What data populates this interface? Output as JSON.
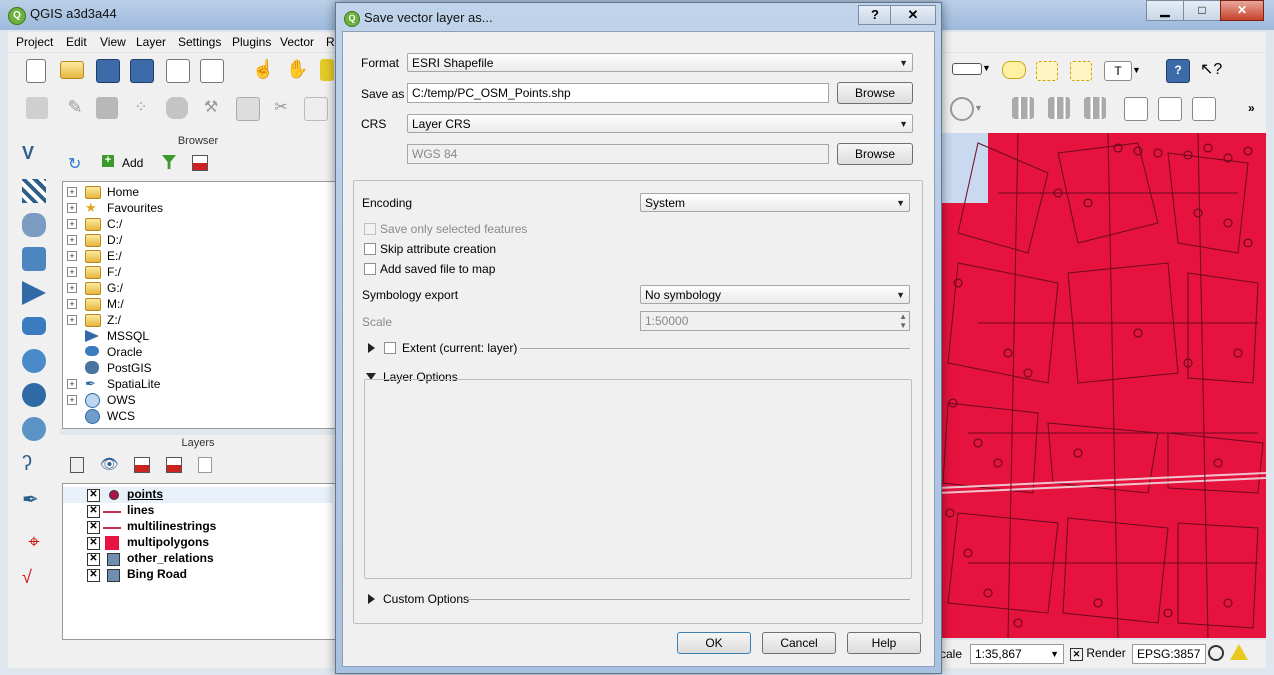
{
  "main_window": {
    "title": "QGIS a3d3a44",
    "menu": [
      "Project",
      "Edit",
      "View",
      "Layer",
      "Settings",
      "Plugins",
      "Vector",
      "Ra"
    ]
  },
  "browser": {
    "title": "Browser",
    "add_label": "Add",
    "items": [
      "Home",
      "Favourites",
      "C:/",
      "D:/",
      "E:/",
      "F:/",
      "G:/",
      "M:/",
      "Z:/",
      "MSSQL",
      "Oracle",
      "PostGIS",
      "SpatiaLite",
      "OWS",
      "WCS"
    ]
  },
  "layers": {
    "title": "Layers",
    "items": [
      "points",
      "lines",
      "multilinestrings",
      "multipolygons",
      "other_relations",
      "Bing Road"
    ]
  },
  "statusbar": {
    "scale_label": "cale",
    "scale_value": "1:35,867",
    "render_label": "Render",
    "crs": "EPSG:3857"
  },
  "dialog": {
    "title": "Save vector layer as...",
    "help_glyph": "?",
    "close_glyph": "✕",
    "format_label": "Format",
    "format_value": "ESRI Shapefile",
    "save_as_label": "Save as",
    "save_as_value": "C:/temp/PC_OSM_Points.shp",
    "browse_label": "Browse",
    "crs_label": "CRS",
    "crs_value": "Layer CRS",
    "crs_name": "WGS 84",
    "encoding_label": "Encoding",
    "encoding_value": "System",
    "save_selected_label": "Save only selected features",
    "skip_attr_label": "Skip attribute creation",
    "add_saved_label": "Add saved file to map",
    "symbology_label": "Symbology export",
    "symbology_value": "No symbology",
    "scale_label": "Scale",
    "scale_value": "1:50000",
    "extent_label": "Extent (current: layer)",
    "layer_options_label": "Layer Options",
    "custom_options_label": "Custom Options",
    "ok_label": "OK",
    "cancel_label": "Cancel",
    "help_label": "Help"
  },
  "colors": {
    "map_fill": "#e6133e",
    "layer_points": "#b0134a",
    "layer_lines": "#c8304a",
    "layer_polygons": "#e6133e"
  }
}
